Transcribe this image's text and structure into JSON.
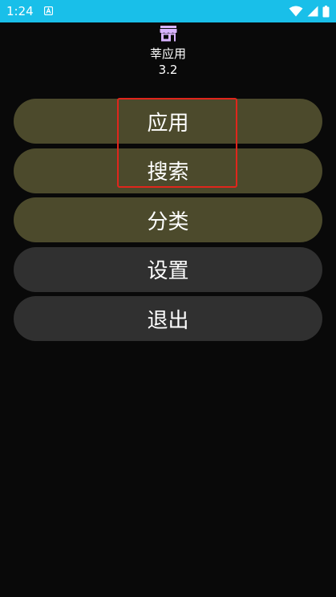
{
  "status_bar": {
    "time": "1:24",
    "notification_icon": "a-letter-icon",
    "icons": [
      "wifi-icon",
      "signal-icon",
      "battery-icon"
    ],
    "background": "#19bfe9"
  },
  "header": {
    "app_icon": "store-icon",
    "app_icon_color": "#d9b3ff",
    "app_name": "莘应用",
    "version": "3.2"
  },
  "menu": {
    "items": [
      {
        "label": "应用",
        "style": "accent"
      },
      {
        "label": "搜索",
        "style": "accent"
      },
      {
        "label": "分类",
        "style": "accent"
      },
      {
        "label": "设置",
        "style": "muted"
      },
      {
        "label": "退出",
        "style": "muted"
      }
    ],
    "accent_color": "#4c4a2c",
    "muted_color": "#303030"
  },
  "annotation": {
    "highlight_color": "#e0261c"
  }
}
